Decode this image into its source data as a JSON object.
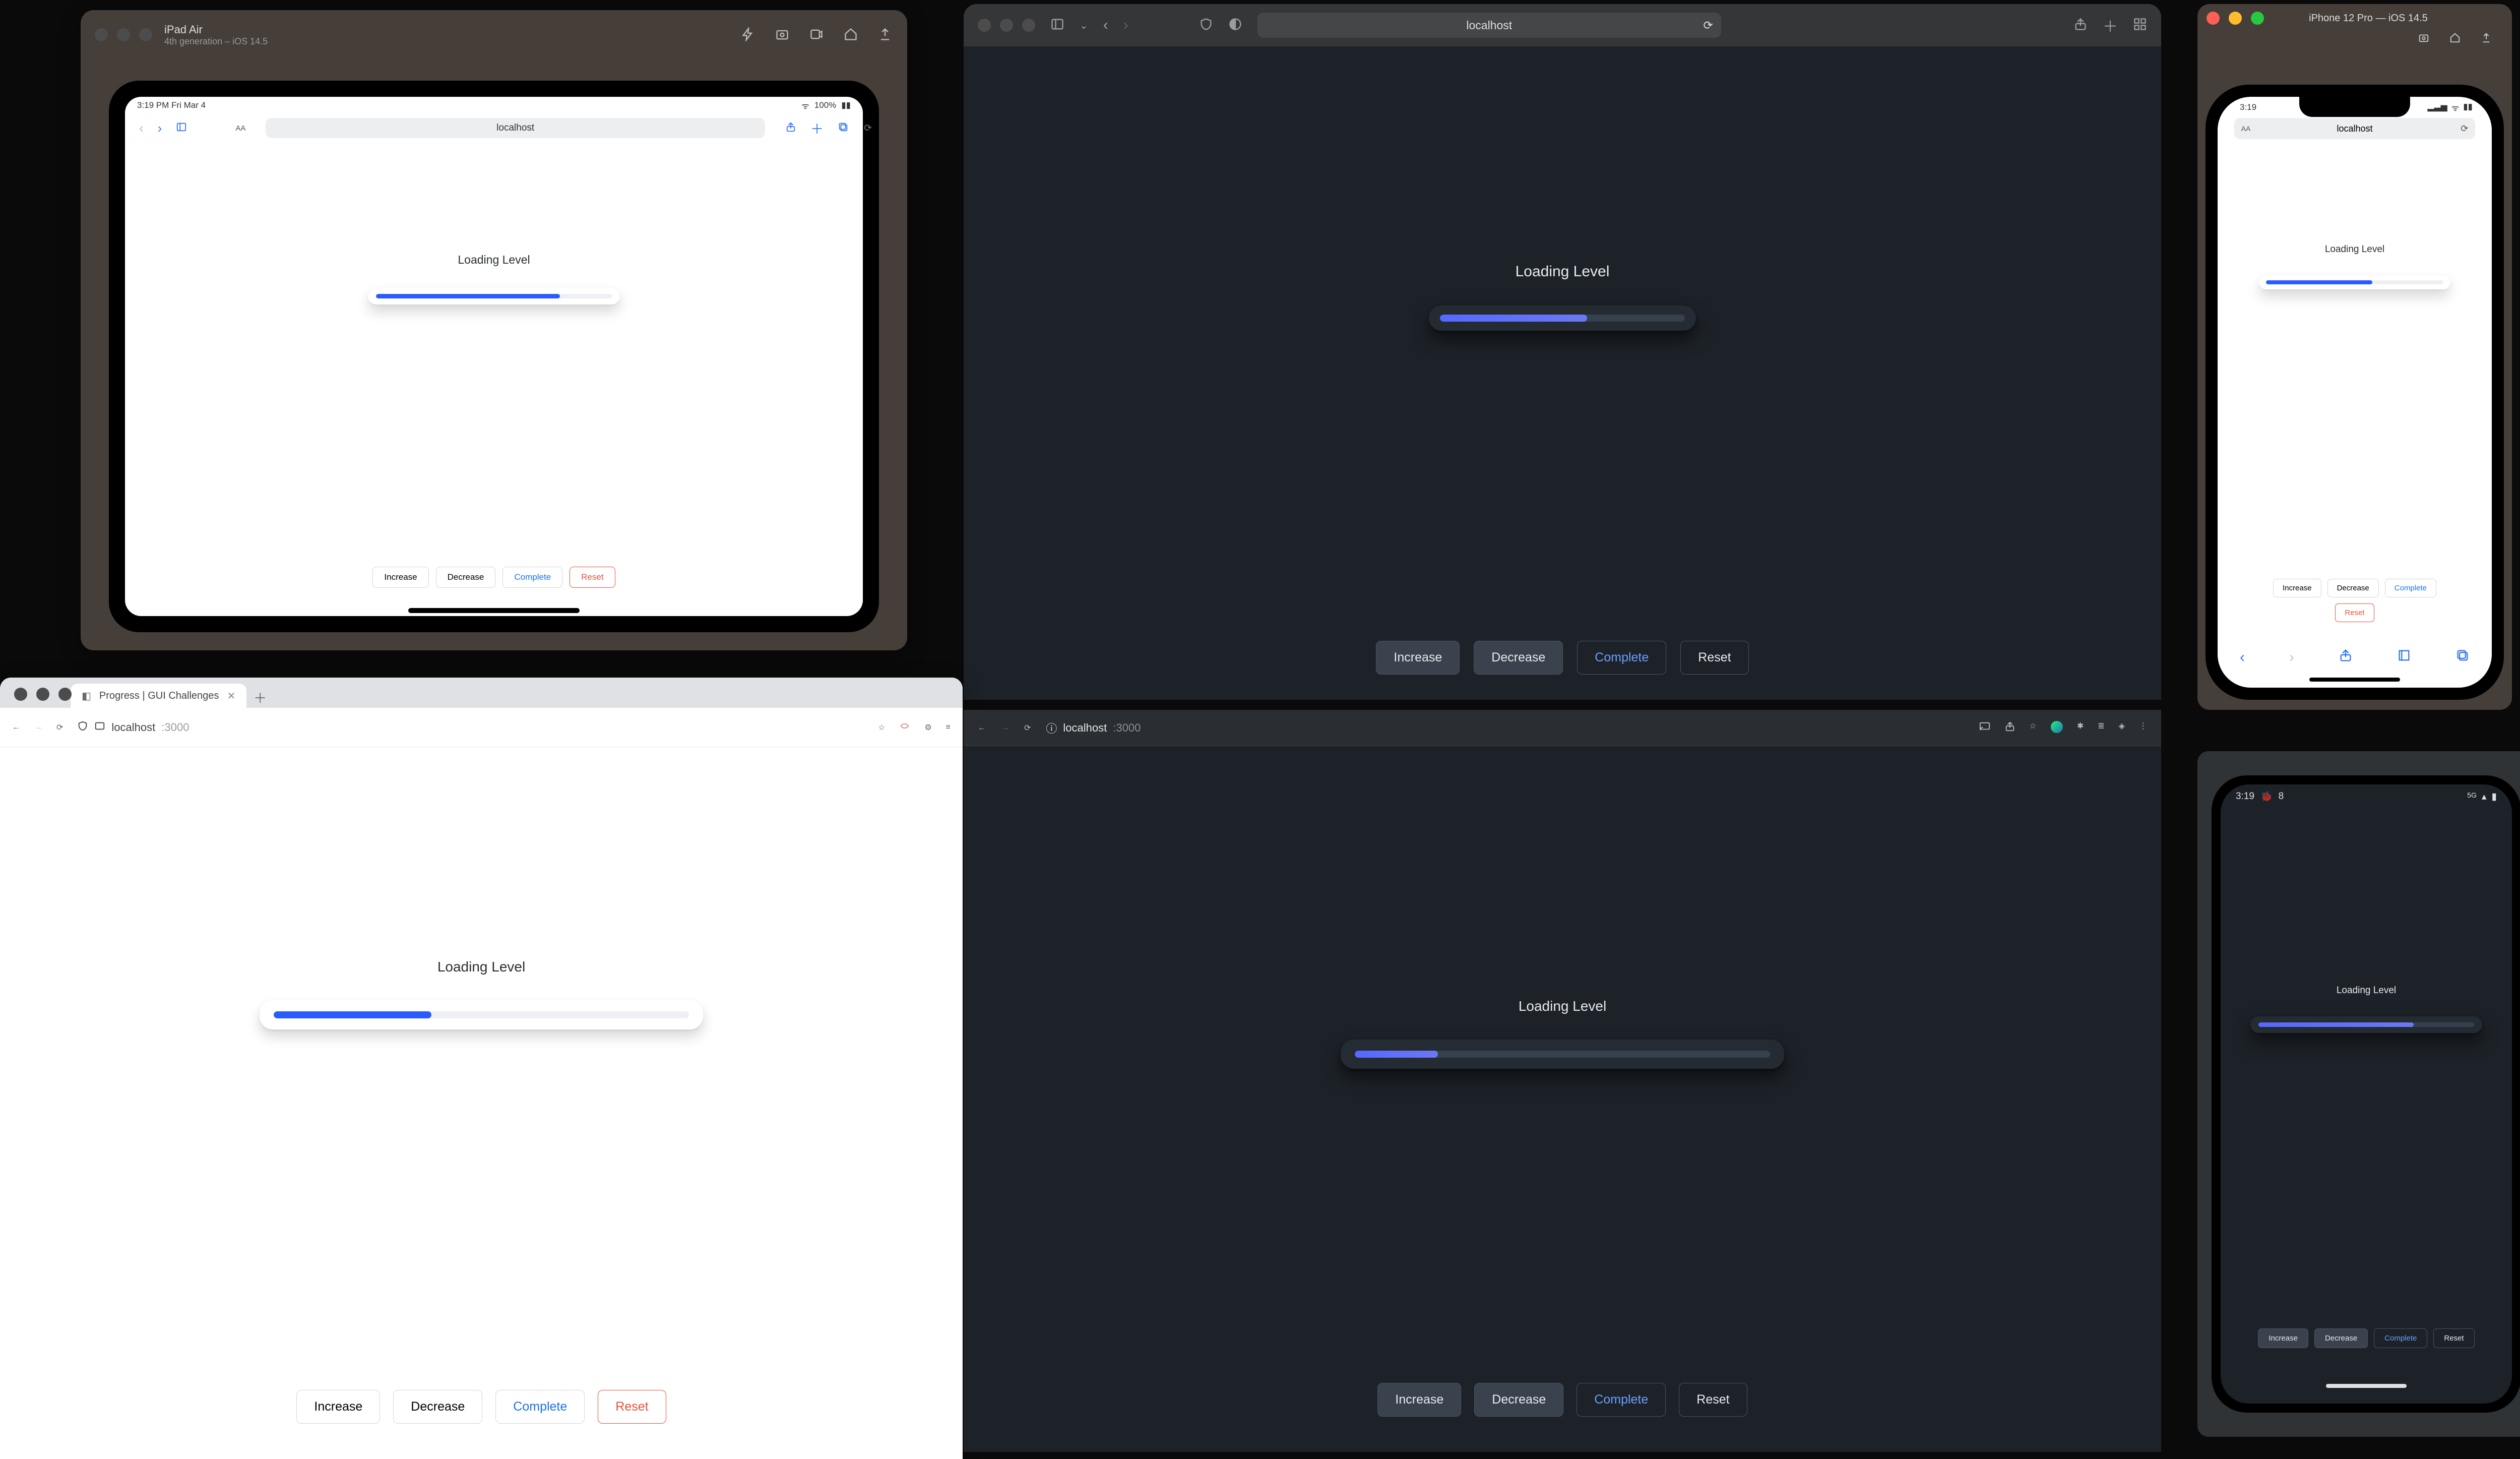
{
  "app": {
    "heading": "Loading Level",
    "buttons": {
      "increase": "Increase",
      "decrease": "Decrease",
      "complete": "Complete",
      "reset": "Reset"
    }
  },
  "ipad": {
    "window_title": "iPad Air",
    "window_subtitle": "4th generation – iOS 14.5",
    "status_time": "3:19 PM   Fri Mar 4",
    "status_battery": "100%",
    "address": "localhost",
    "aa": "AA",
    "progress_pct": 78
  },
  "safari": {
    "address": "localhost",
    "progress_pct": 60
  },
  "chrome_light": {
    "tab_title": "Progress | GUI Challenges",
    "host": "localhost",
    "port": ":3000",
    "progress_pct": 38
  },
  "chrome_dark": {
    "host": "localhost",
    "port": ":3000",
    "progress_pct": 20
  },
  "iphone": {
    "window_title": "iPhone 12 Pro — iOS 14.5",
    "status_time": "3:19",
    "address": "localhost",
    "aa": "AA",
    "progress_pct": 60
  },
  "android": {
    "status_time": "3:19",
    "status_debug": "8",
    "progress_pct": 72
  },
  "colors": {
    "accent_light": "#2a5bff",
    "accent_dark": "#6172f5",
    "complete_light": "#1b73e8",
    "complete_dark": "#6b9eff",
    "reset_light": "#e5533b"
  },
  "icons": {
    "zap": "zap-icon",
    "screenshot": "screenshot-icon",
    "record": "record-screen-icon",
    "home": "home-icon",
    "export": "export-icon",
    "back": "chevron-left-icon",
    "forward": "chevron-right-icon",
    "sidebar": "sidebar-icon",
    "share": "share-icon",
    "plus": "plus-icon",
    "tabs": "tabs-icon",
    "shield": "shield-icon",
    "appearance": "appearance-icon",
    "reload": "reload-icon",
    "grid": "grid-icon",
    "lock": "lock-icon",
    "book": "book-icon"
  }
}
